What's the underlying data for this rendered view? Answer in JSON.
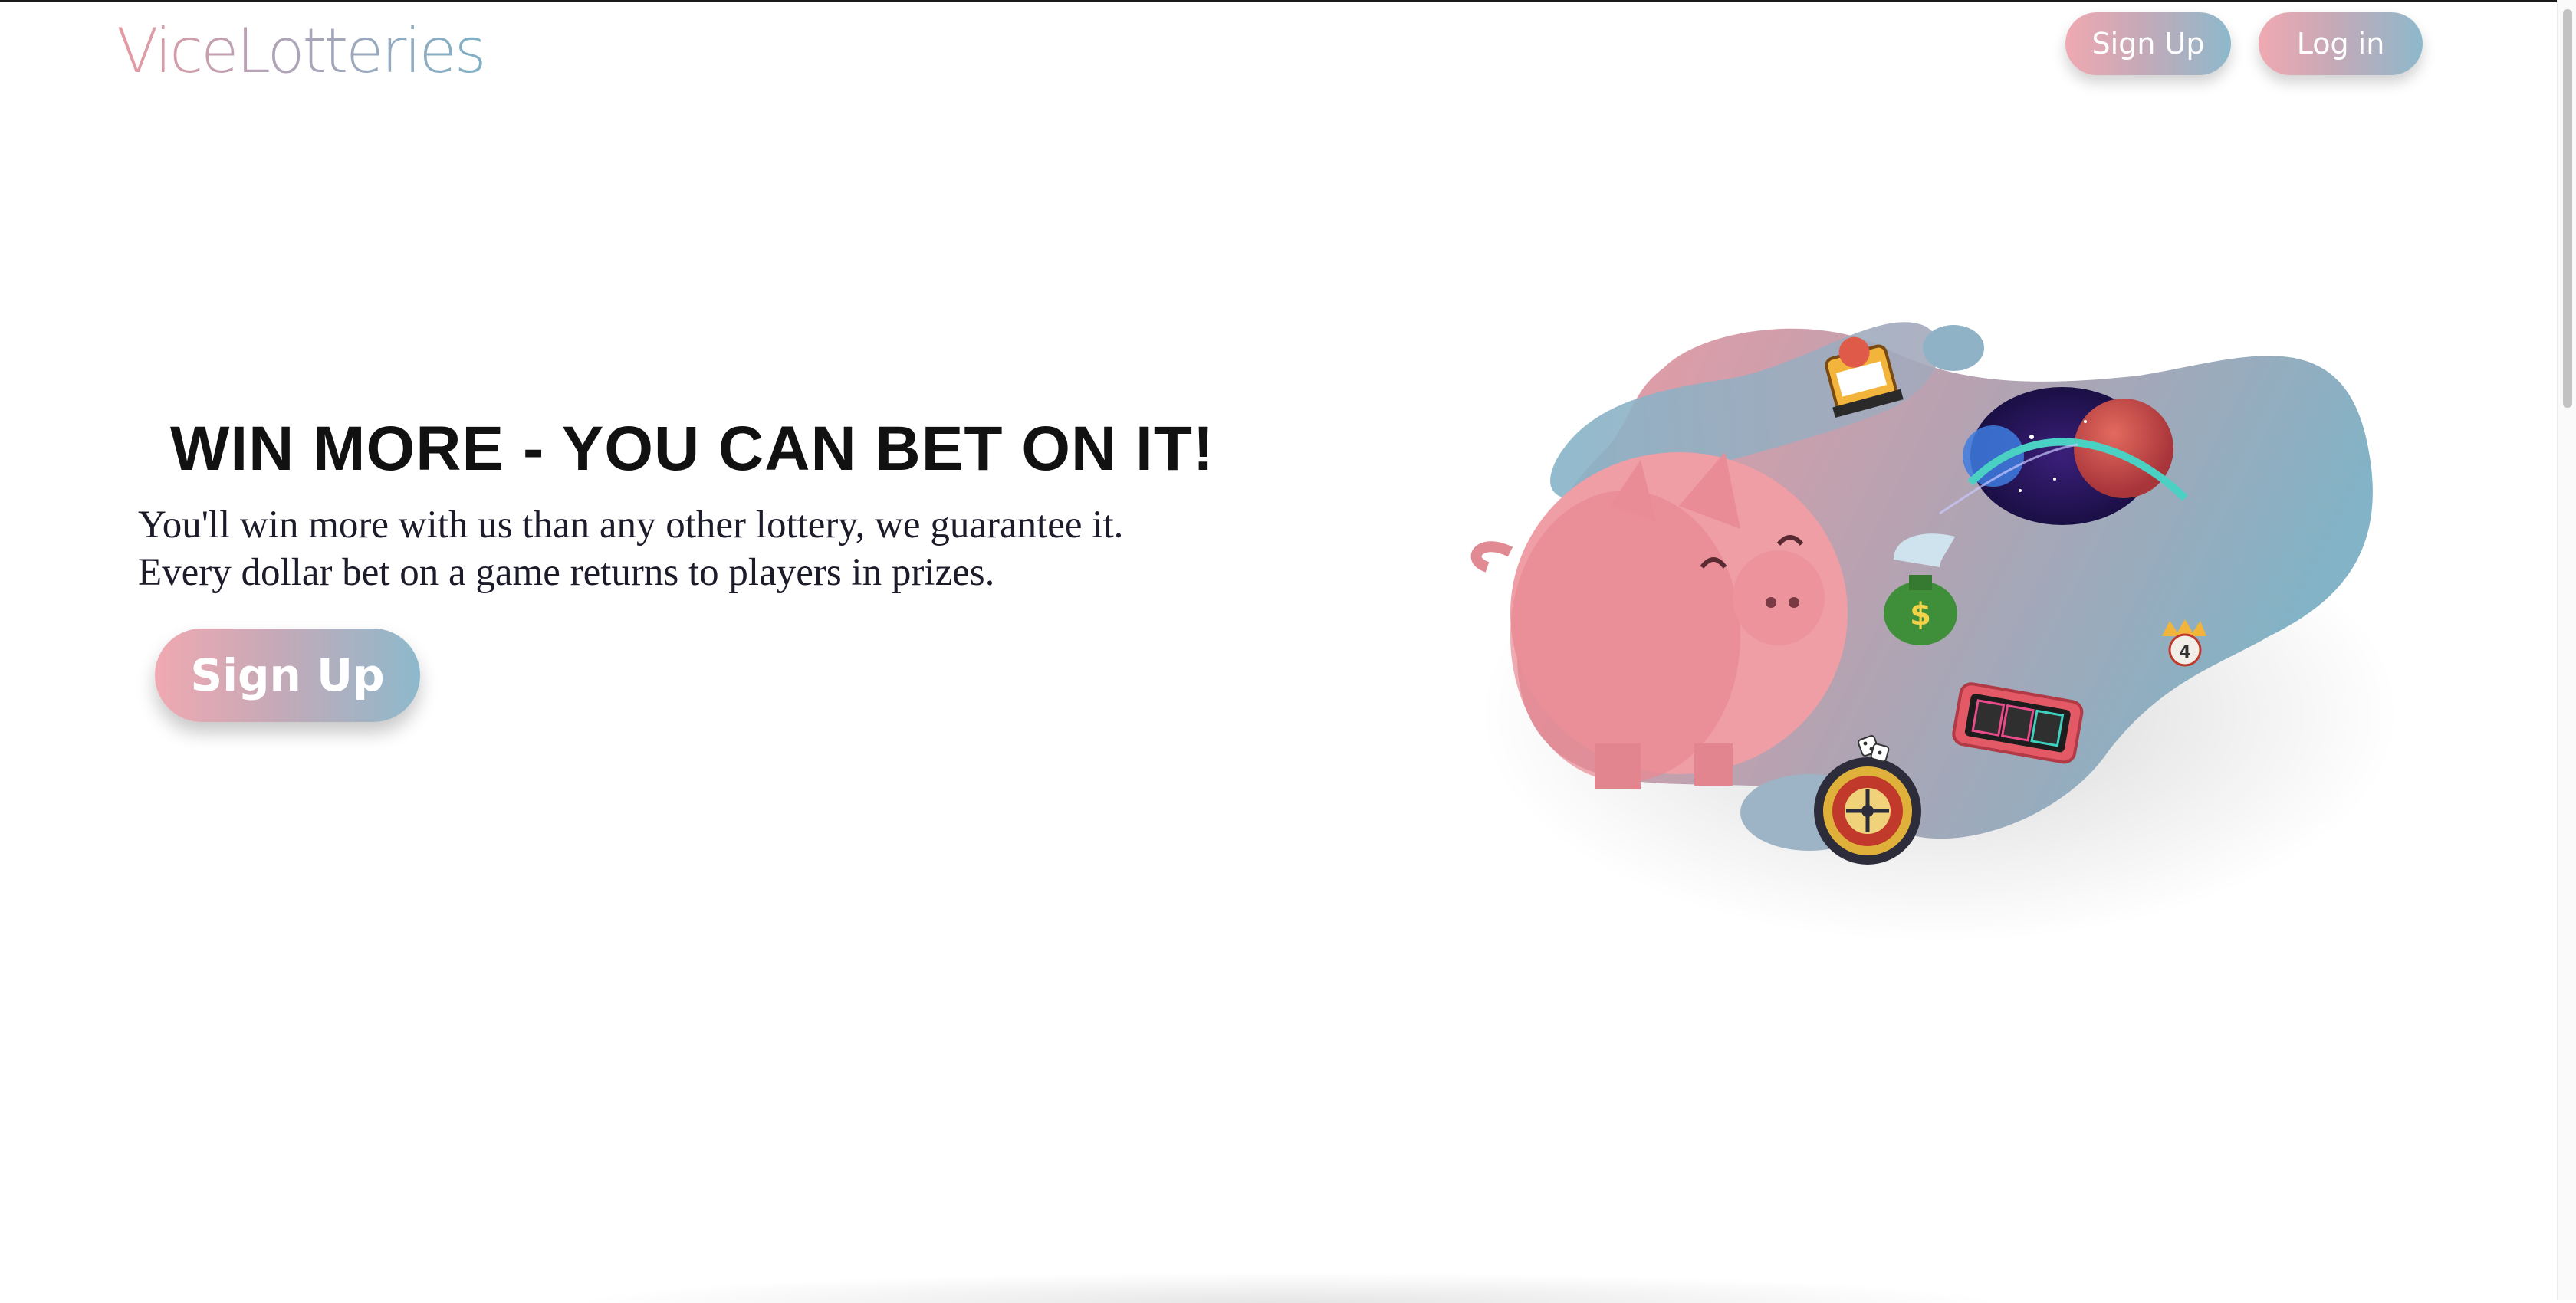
{
  "header": {
    "logo_text": "ViceLotteries",
    "signup_label": "Sign Up",
    "login_label": "Log in"
  },
  "hero": {
    "title": "WIN MORE - YOU CAN BET ON IT!",
    "line1": "You'll win more with us than any other lottery, we guarantee it.",
    "line2": "Every dollar bet on a game returns to players in prizes.",
    "cta_label": "Sign Up"
  },
  "illustration": {
    "icons": [
      "piggy-bank-icon",
      "slot-machine-icon",
      "planet-icon",
      "money-bag-icon",
      "lottery-ball-icon",
      "roulette-icon",
      "dice-icon",
      "slot-reels-icon"
    ],
    "money_symbol": "$",
    "ball_number": "4"
  },
  "colors": {
    "pink": "#f0a9b1",
    "blue": "#8db9cc",
    "text": "#111111"
  }
}
